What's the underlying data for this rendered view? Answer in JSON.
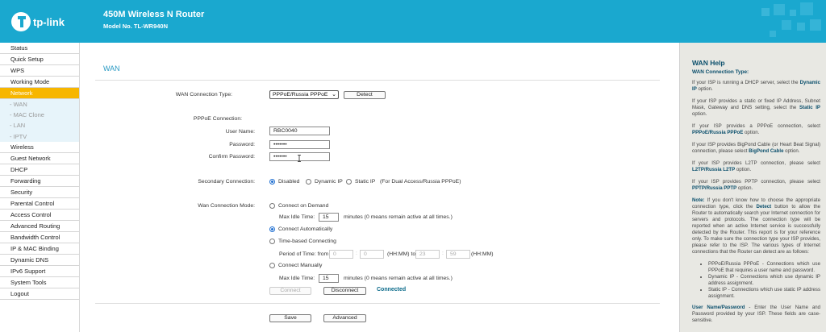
{
  "header": {
    "brand": "tp-link",
    "title": "450M Wireless N Router",
    "model": "Model No. TL-WR940N",
    "bg_color": "#1aa8cf"
  },
  "sidebar": {
    "items": [
      {
        "label": "Status"
      },
      {
        "label": "Quick Setup"
      },
      {
        "label": "WPS"
      },
      {
        "label": "Working Mode"
      },
      {
        "label": "Network",
        "active": true
      },
      {
        "label": "- WAN",
        "sub": true
      },
      {
        "label": "- MAC Clone",
        "sub": true
      },
      {
        "label": "- LAN",
        "sub": true
      },
      {
        "label": "- IPTV",
        "sub": true
      },
      {
        "label": "Wireless"
      },
      {
        "label": "Guest Network"
      },
      {
        "label": "DHCP"
      },
      {
        "label": "Forwarding"
      },
      {
        "label": "Security"
      },
      {
        "label": "Parental Control"
      },
      {
        "label": "Access Control"
      },
      {
        "label": "Advanced Routing"
      },
      {
        "label": "Bandwidth Control"
      },
      {
        "label": "IP & MAC Binding"
      },
      {
        "label": "Dynamic DNS"
      },
      {
        "label": "IPv6 Support"
      },
      {
        "label": "System Tools"
      },
      {
        "label": "Logout"
      }
    ],
    "active_color": "#f7b600"
  },
  "main": {
    "title": "WAN",
    "conn_type_label": "WAN Connection Type:",
    "conn_type_value": "PPPoE/Russia PPPoE",
    "detect_label": "Detect",
    "pppoe_label": "PPPoE Connection:",
    "username_label": "User Name:",
    "username_value": "RBC0040",
    "password_label": "Password:",
    "password_value": "•••••••",
    "confirm_label": "Confirm Password:",
    "confirm_value": "•••••••",
    "secondary_label": "Secondary Connection:",
    "sec_disabled": "Disabled",
    "sec_dynamic": "Dynamic IP",
    "sec_static": "Static IP",
    "sec_note": "(For Dual Access/Russia PPPoE)",
    "mode_label": "Wan Connection Mode:",
    "mode_demand": "Connect on Demand",
    "idle_label": "Max Idle Time:",
    "idle_value": "15",
    "idle_note": "minutes (0 means remain active at all times.)",
    "mode_auto": "Connect Automatically",
    "mode_time": "Time-based Connecting",
    "period_label": "Period of Time: from",
    "from_h": "0",
    "from_m": "0",
    "hhmm1": "(HH:MM) to",
    "to_h": "23",
    "to_m": "59",
    "hhmm2": "(HH:MM)",
    "colon": ":",
    "mode_manual": "Connect Manually",
    "idle2_value": "15",
    "connect_label": "Connect",
    "disconnect_label": "Disconnect",
    "status": "Connected",
    "save_label": "Save",
    "advanced_label": "Advanced"
  },
  "help": {
    "title": "WAN Help",
    "subtitle": "WAN Connection Type:",
    "p1a": "If your ISP is running a DHCP server, select the ",
    "p1b": "Dynamic IP",
    " p1c": " option.",
    "p2a": "If your ISP provides a static or fixed IP Address, Subnet Mask, Gateway and DNS setting, select the ",
    "p2b": "Static IP",
    "p2c": " option.",
    "p3a": "If your ISP provides a PPPoE connection, select ",
    "p3b": "PPPoE/Russia PPPoE",
    "p3c": " option.",
    "p4a": "If your ISP provides BigPond Cable (or Heart Beat Signal) connection, please select ",
    "p4b": "BigPond Cable",
    "p4c": " option.",
    "p5a": "If your ISP provides L2TP connection, please select ",
    "p5b": "L2TP/Russia L2TP",
    "p5c": " option.",
    "p6a": "If your ISP provides PPTP connection, please select ",
    "p6b": "PPTP/Russia PPTP",
    "p6c": " option.",
    "note_a": "Note:",
    "note_b": " If you don't know how to choose the appropriate connection type, click the ",
    "note_c": "Detect",
    "note_d": " button to allow the Router to automatically search your Internet connection for servers and protocols. The connection type will be reported when an active Internet service is successfully detected by the Router. This report is for your reference only. To make sure the connection type your ISP provides, please refer to the ISP. The various types of Internet connections that the Router can detect are as follows:",
    "li1": "PPPoE/Russia PPPoE - Connections which use PPPoE that requires a user name and password.",
    "li2": "Dynamic IP - Connections which use dynamic IP address assignment.",
    "li3": "Static IP - Connections which use static IP address assignment.",
    "up_a": "User Name/Password",
    "up_b": " - Enter the User Name and Password provided by your ISP. These fields are case-sensitive."
  }
}
